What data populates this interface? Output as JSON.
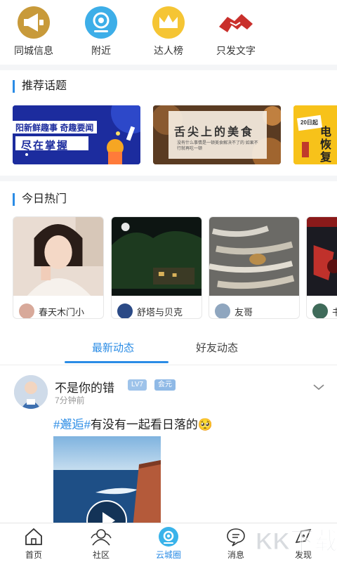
{
  "quick_nav": [
    {
      "label": "同城信息",
      "icon": "megaphone-icon",
      "color": "#c89a3a"
    },
    {
      "label": "附近",
      "icon": "location-eye-icon",
      "color": "#3daee8"
    },
    {
      "label": "达人榜",
      "icon": "crown-icon",
      "color": "#f5c534"
    },
    {
      "label": "只发文字",
      "icon": "handshake-icon",
      "color": "#c9302c"
    }
  ],
  "topics": {
    "title": "推荐话题",
    "banners": [
      {
        "line1": "阳新鲜趣事 奇趣要闻",
        "line2": "尽在掌握"
      },
      {
        "title": "舌尖上的美食",
        "subtitle": "没有什么事情是一顿美食解决不了的 如果不行就再吃一顿"
      },
      {
        "badge": "20日起",
        "text": "电 恢复"
      }
    ]
  },
  "hot": {
    "title": "今日热门",
    "cards": [
      {
        "name": "春天木门小"
      },
      {
        "name": "舒塔与贝克"
      },
      {
        "name": "友哥"
      },
      {
        "name": "书"
      }
    ]
  },
  "tabs": {
    "latest": "最新动态",
    "friends": "好友动态"
  },
  "post": {
    "author": "不是你的错",
    "level": "LV7",
    "member": "会元",
    "time": "7分钟前",
    "hashtag": "#邂逅#",
    "text": "有没有一起看日落的",
    "emoji": "🥺"
  },
  "bottom_nav": [
    {
      "label": "首页",
      "icon": "home-icon"
    },
    {
      "label": "社区",
      "icon": "community-icon"
    },
    {
      "label": "云城圈",
      "icon": "cloud-circle-icon",
      "active": true
    },
    {
      "label": "消息",
      "icon": "message-icon"
    },
    {
      "label": "发现",
      "icon": "discover-icon"
    }
  ],
  "watermark": "KK下载"
}
